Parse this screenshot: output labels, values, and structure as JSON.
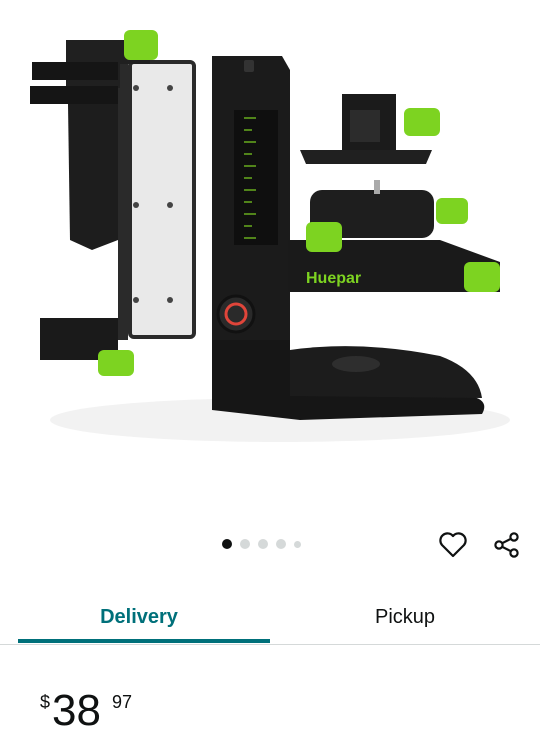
{
  "product": {
    "image_alt": "Laser level wall mount bracket with adjustable base and clamp",
    "brand_logo": "Huepar"
  },
  "carousel": {
    "count": 5,
    "active_index": 0
  },
  "actions": {
    "wishlist_icon": "heart-outline-icon",
    "share_icon": "share-icon"
  },
  "tabs": [
    {
      "label": "Delivery",
      "selected": true
    },
    {
      "label": "Pickup",
      "selected": false
    }
  ],
  "price": {
    "symbol": "$",
    "whole": "38",
    "fraction": "97"
  },
  "colors": {
    "accent": "#00707a",
    "lime": "#7dd321",
    "body": "#1c1c1c"
  }
}
